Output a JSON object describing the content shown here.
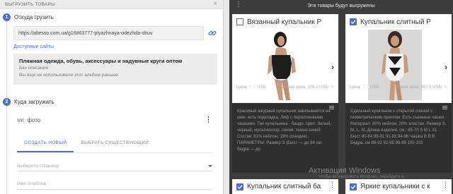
{
  "left": {
    "title": "ВЫГРУЗИТЬ ТОВАРЫ",
    "step1": {
      "num": "1",
      "label": "Откуда грузить"
    },
    "url": "https://altesso.com.ua/g16863777-plyazhnaya-odezhda-obuv",
    "available_sites": "Доступные сайты",
    "album": {
      "title": "Пляжная одежда, обувь, аксессуары и надувные круги оптом",
      "subtitle": "Без описания",
      "note": "Вы еще не использовали этот альбом раньше"
    },
    "step2": {
      "num": "2",
      "label": "Куда загружать"
    },
    "vk": {
      "logo": "VK",
      "label": "фото"
    },
    "tabs": [
      {
        "label": "СОЗДАТЬ НОВЫЙ"
      },
      {
        "label": "ВЫБРАТЬ СУЩЕСТВУЮЩИЙ"
      }
    ],
    "page_select_placeholder": "Выберите страницу",
    "album_name_placeholder": "Имя Альбома"
  },
  "right": {
    "title": "Эти товары будут выгружены",
    "cards": [
      {
        "title": "Вязанный купальник Р",
        "checked": false,
        "description": "Красивый ажурный купальник завязывается на шее, есть подкладка. Лиф с поролоновыми чашками. Тип купальника - бандо. Цвет: белый, черный, мультиколор, синий. темно-синий Состав: 81% нейлон, 19% спандекс, ПАРАМЕТРЫ: Размер S (Бюст — до 84 см; бедра — до",
        "price_label": "Цена:",
        "price": "9,2",
        "currency": "USD",
        "new_price_label": "Новая цена:",
        "new_price": "109.2 USD"
      },
      {
        "title": "Купальник слитный Р",
        "checked": true,
        "description": "Сдельный купальник с открытой спиной с геометрическим принтом. Есть съемные чашки. Материал: 80% нейлон, 20% эластан. Размер S, M, L, XL Длина изделия, см.: 65-70 S M L XL Бюст 80-84 88-91 91-93 94-98 Чашка В В В Бедра, см 88-92 92-95 96-99 100-103",
        "price_label": "Цена:",
        "price": "7,5",
        "currency": "USD",
        "new_price_label": "Новая цена:",
        "new_price": "107.5 USD"
      }
    ],
    "bottom_cards": [
      {
        "title": "Купальник слитный ба",
        "checked": true
      },
      {
        "title": "Яркие купальники с к",
        "checked": true
      }
    ],
    "watermark": "Активация Windows",
    "watermark_sub": "Чтобы активировать Windows, перейдите в"
  },
  "colors": {
    "accent": "#4a6fc7",
    "dark_bg": "#3d3d3d",
    "card_bg": "#2f2f2f"
  }
}
